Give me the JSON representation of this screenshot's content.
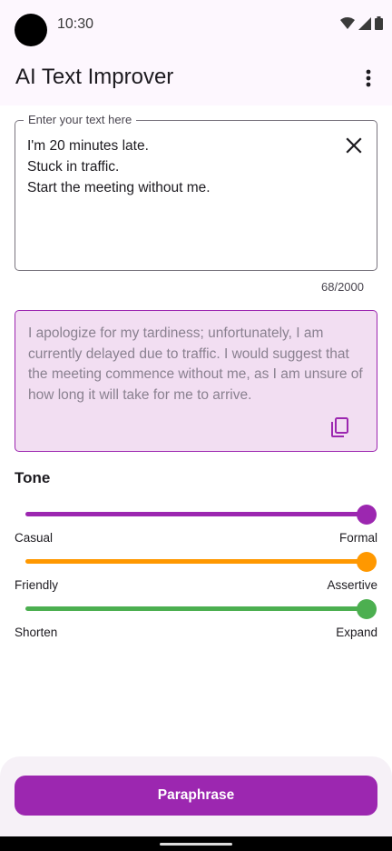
{
  "status_bar": {
    "time": "10:30",
    "icons": [
      "wifi-icon",
      "signal-icon",
      "battery-icon"
    ]
  },
  "app_bar": {
    "title": "AI Text Improver",
    "menu_icon": "more-vert-icon"
  },
  "input": {
    "label": "Enter your text here",
    "value": "I'm 20 minutes late.\nStuck in traffic.\nStart the meeting without me.",
    "counter": "68/2000",
    "clear_icon": "close-icon"
  },
  "output": {
    "text": "I apologize for my tardiness; unfortunately, I am currently delayed due to traffic. I would suggest that the meeting commence without me, as I am unsure of how long it will take for me to arrive.",
    "copy_icon": "copy-icon"
  },
  "tone": {
    "title": "Tone",
    "sliders": [
      {
        "left": "Casual",
        "right": "Formal",
        "value": 1.0,
        "color": "#9c27b0"
      },
      {
        "left": "Friendly",
        "right": "Assertive",
        "value": 1.0,
        "color": "#ff9800"
      },
      {
        "left": "Shorten",
        "right": "Expand",
        "value": 1.0,
        "color": "#4caf50"
      }
    ]
  },
  "action": {
    "paraphrase_label": "Paraphrase"
  },
  "colors": {
    "accent": "#9c27b0",
    "app_bar_bg": "#fdf7fe",
    "output_bg": "#f2def2"
  }
}
